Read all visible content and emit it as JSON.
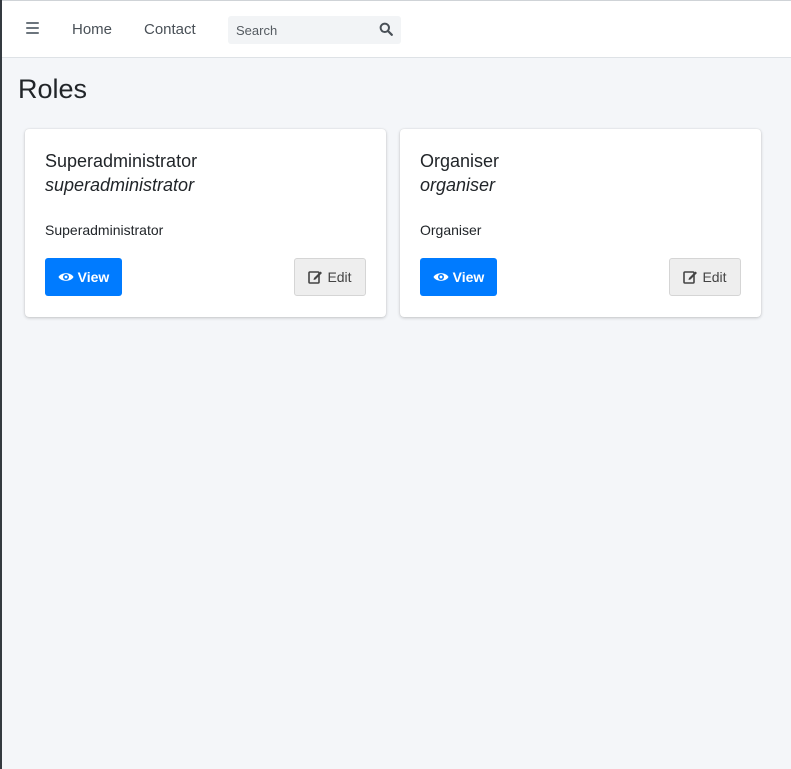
{
  "nav": {
    "home_label": "Home",
    "contact_label": "Contact",
    "search_placeholder": "Search"
  },
  "page": {
    "title": "Roles"
  },
  "roles": [
    {
      "name": "Superadministrator",
      "slug": "superadministrator",
      "description": "Superadministrator",
      "view_label": "View",
      "edit_label": "Edit"
    },
    {
      "name": "Organiser",
      "slug": "organiser",
      "description": "Organiser",
      "view_label": "View",
      "edit_label": "Edit"
    }
  ],
  "colors": {
    "primary": "#007bff",
    "background": "#f4f6f9",
    "navbar": "#ffffff"
  },
  "icons": {
    "menu": "hamburger-icon",
    "search": "search-icon",
    "view": "eye-icon",
    "edit": "edit-icon"
  }
}
